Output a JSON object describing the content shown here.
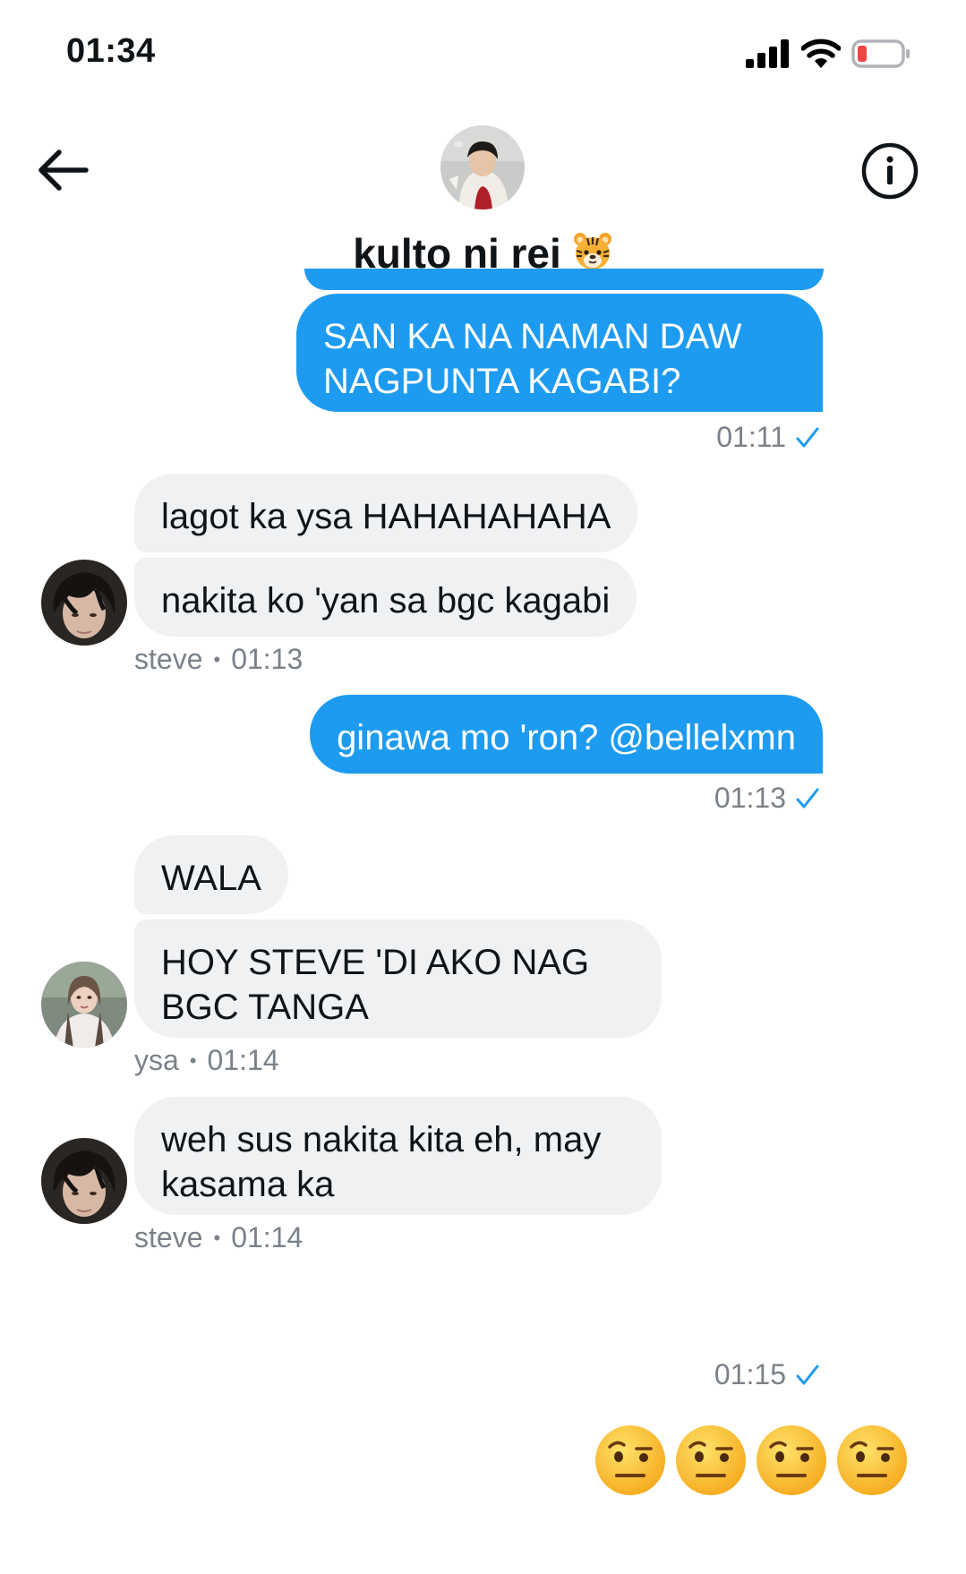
{
  "status_bar": {
    "time": "01:34",
    "battery_color": "#ef4444"
  },
  "header": {
    "back_icon": "arrow-left-icon",
    "info_icon": "info-circle-icon",
    "group_name": "kulto ni rei",
    "group_emoji": "tiger-face-emoji"
  },
  "colors": {
    "outgoing": "#1d9bf0",
    "incoming": "#eff1f3",
    "meta": "#7a8189"
  },
  "messages": [
    {
      "side": "out",
      "text": "SAN KA NA NAMAN DAW NAGPUNTA KAGABI?",
      "time": "01:11"
    },
    {
      "side": "in",
      "text": "lagot ka ysa HAHAHAHAHA"
    },
    {
      "side": "in",
      "text": "nakita ko 'yan sa bgc kagabi",
      "sender": "steve",
      "time": "01:13"
    },
    {
      "side": "out",
      "text": "ginawa mo 'ron? @bellelxmn",
      "time": "01:13"
    },
    {
      "side": "in",
      "text": "WALA"
    },
    {
      "side": "in",
      "text": "HOY STEVE 'DI AKO NAG BGC TANGA",
      "sender": "ysa",
      "time": "01:14"
    },
    {
      "side": "in",
      "text": "weh sus nakita kita eh, may kasama ka",
      "sender": "steve",
      "time": "01:14"
    },
    {
      "side": "out",
      "emojis": [
        "face-with-raised-eyebrow",
        "face-with-raised-eyebrow",
        "face-with-raised-eyebrow",
        "face-with-raised-eyebrow"
      ],
      "time": "01:15"
    }
  ],
  "meta_separator": "•"
}
